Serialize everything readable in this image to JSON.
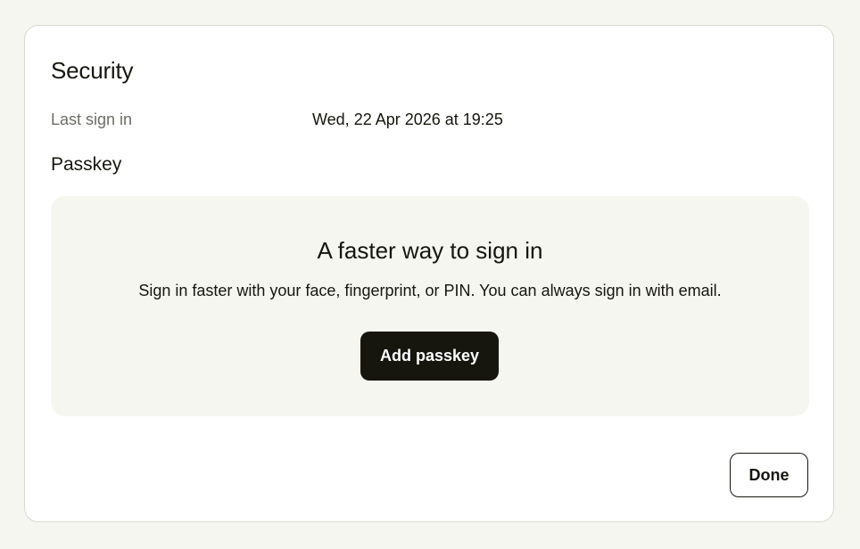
{
  "dialog": {
    "title": "Security",
    "last_sign_in": {
      "label": "Last sign in",
      "value": "Wed, 22 Apr 2026 at 19:25"
    },
    "passkey": {
      "section_title": "Passkey",
      "heading": "A faster way to sign in",
      "description": "Sign in faster with your face, fingerprint, or PIN. You can always sign in with email.",
      "add_button_label": "Add passkey"
    },
    "done_button_label": "Done"
  },
  "colors": {
    "page_background": "#f6f6f1",
    "dialog_background": "#ffffff",
    "primary_button": "#16160f",
    "muted_text": "#6d6d66"
  }
}
